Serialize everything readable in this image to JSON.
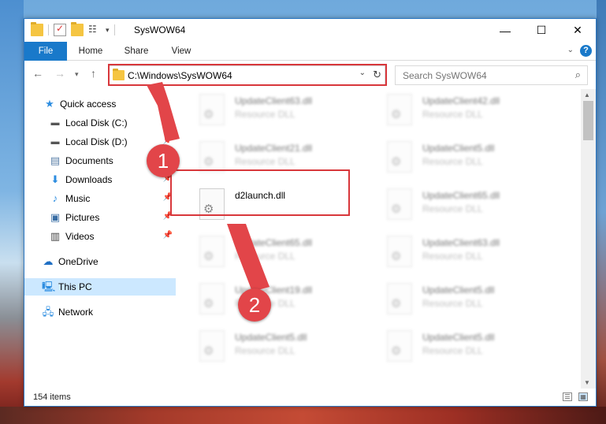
{
  "window": {
    "title": "SysWOW64"
  },
  "ribbon": {
    "tabs": [
      "File",
      "Home",
      "Share",
      "View"
    ]
  },
  "address": {
    "path": "C:\\Windows\\SysWOW64",
    "search_placeholder": "Search SysWOW64"
  },
  "nav": {
    "items": [
      {
        "label": "Quick access",
        "icon": "star-icon",
        "pinned": false
      },
      {
        "label": "Local Disk (C:)",
        "icon": "drive-icon",
        "pinned": true
      },
      {
        "label": "Local Disk (D:)",
        "icon": "drive-icon",
        "pinned": true
      },
      {
        "label": "Documents",
        "icon": "document-icon",
        "pinned": true
      },
      {
        "label": "Downloads",
        "icon": "download-icon",
        "pinned": true
      },
      {
        "label": "Music",
        "icon": "music-icon",
        "pinned": true
      },
      {
        "label": "Pictures",
        "icon": "pictures-icon",
        "pinned": true
      },
      {
        "label": "Videos",
        "icon": "video-icon",
        "pinned": true
      },
      {
        "label": "OneDrive",
        "icon": "cloud-icon",
        "pinned": false
      },
      {
        "label": "This PC",
        "icon": "computer-icon",
        "pinned": false,
        "selected": true
      },
      {
        "label": "Network",
        "icon": "network-icon",
        "pinned": false
      }
    ]
  },
  "files": {
    "left": [
      {
        "name": "UpdateClient63.dll",
        "type": "Resource DLL"
      },
      {
        "name": "UpdateClient21.dll",
        "type": "Resource DLL"
      },
      {
        "name": "d2launch.dll",
        "type": ""
      },
      {
        "name": "UpdateClient65.dll",
        "type": "Resource DLL"
      },
      {
        "name": "UpdateClient19.dll",
        "type": "Resource DLL"
      },
      {
        "name": "UpdateClient5.dll",
        "type": "Resource DLL"
      }
    ],
    "right": [
      {
        "name": "UpdateClient42.dll",
        "type": "Resource DLL"
      },
      {
        "name": "UpdateClient5.dll",
        "type": "Resource DLL"
      },
      {
        "name": "UpdateClient65.dll",
        "type": "Resource DLL"
      },
      {
        "name": "UpdateClient63.dll",
        "type": "Resource DLL"
      },
      {
        "name": "UpdateClient5.dll",
        "type": "Resource DLL"
      },
      {
        "name": "UpdateClient5.dll",
        "type": "Resource DLL"
      }
    ]
  },
  "status": {
    "item_count": "154 items"
  },
  "annotations": {
    "marker1": "1",
    "marker2": "2",
    "highlight_color": "#d8373b"
  }
}
